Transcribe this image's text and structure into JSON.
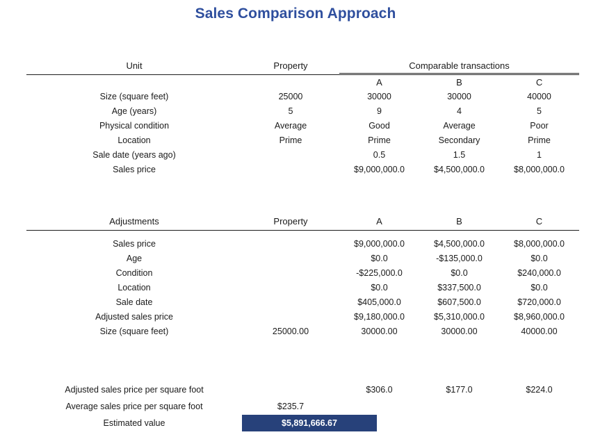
{
  "title": "Sales Comparison Approach",
  "colors": {
    "title": "#2f4f9e",
    "highlight_bg": "#27417a",
    "highlight_text": "#ffffff",
    "rule": "#1b1b1b"
  },
  "table1": {
    "headers": {
      "label": "Unit",
      "property": "Property",
      "comparable_group": "Comparable transactions",
      "a": "A",
      "b": "B",
      "c": "C"
    },
    "rows": [
      {
        "label": "Size (square feet)",
        "property": "25000",
        "a": "30000",
        "b": "30000",
        "c": "40000"
      },
      {
        "label": "Age (years)",
        "property": "5",
        "a": "9",
        "b": "4",
        "c": "5"
      },
      {
        "label": "Physical condition",
        "property": "Average",
        "a": "Good",
        "b": "Average",
        "c": "Poor"
      },
      {
        "label": "Location",
        "property": "Prime",
        "a": "Prime",
        "b": "Secondary",
        "c": "Prime"
      },
      {
        "label": "Sale date (years ago)",
        "property": "",
        "a": "0.5",
        "b": "1.5",
        "c": "1"
      },
      {
        "label": "Sales price",
        "property": "",
        "a": "$9,000,000.0",
        "b": "$4,500,000.0",
        "c": "$8,000,000.0"
      }
    ]
  },
  "table2": {
    "headers": {
      "label": "Adjustments",
      "property": "Property",
      "a": "A",
      "b": "B",
      "c": "C"
    },
    "rows": [
      {
        "label": "Sales price",
        "property": "",
        "a": "$9,000,000.0",
        "b": "$4,500,000.0",
        "c": "$8,000,000.0"
      },
      {
        "label": "Age",
        "property": "",
        "a": "$0.0",
        "b": "-$135,000.0",
        "c": "$0.0"
      },
      {
        "label": "Condition",
        "property": "",
        "a": "-$225,000.0",
        "b": "$0.0",
        "c": "$240,000.0"
      },
      {
        "label": "Location",
        "property": "",
        "a": "$0.0",
        "b": "$337,500.0",
        "c": "$0.0"
      },
      {
        "label": "Sale date",
        "property": "",
        "a": "$405,000.0",
        "b": "$607,500.0",
        "c": "$720,000.0"
      },
      {
        "label": "Adjusted sales price",
        "property": "",
        "a": "$9,180,000.0",
        "b": "$5,310,000.0",
        "c": "$8,960,000.0"
      },
      {
        "label": "Size (square feet)",
        "property": "25000.00",
        "a": "30000.00",
        "b": "30000.00",
        "c": "40000.00"
      }
    ]
  },
  "summary": {
    "rows": [
      {
        "label": "Adjusted sales price per square foot",
        "property": "",
        "a": "$306.0",
        "b": "$177.0",
        "c": "$224.0",
        "highlight": false
      },
      {
        "label": "Average sales price per square foot",
        "property": "$235.7",
        "a": "",
        "b": "",
        "c": "",
        "highlight": false
      },
      {
        "label": "Estimated value",
        "property": "$5,891,666.67",
        "a": "",
        "b": "",
        "c": "",
        "highlight": true
      }
    ]
  }
}
